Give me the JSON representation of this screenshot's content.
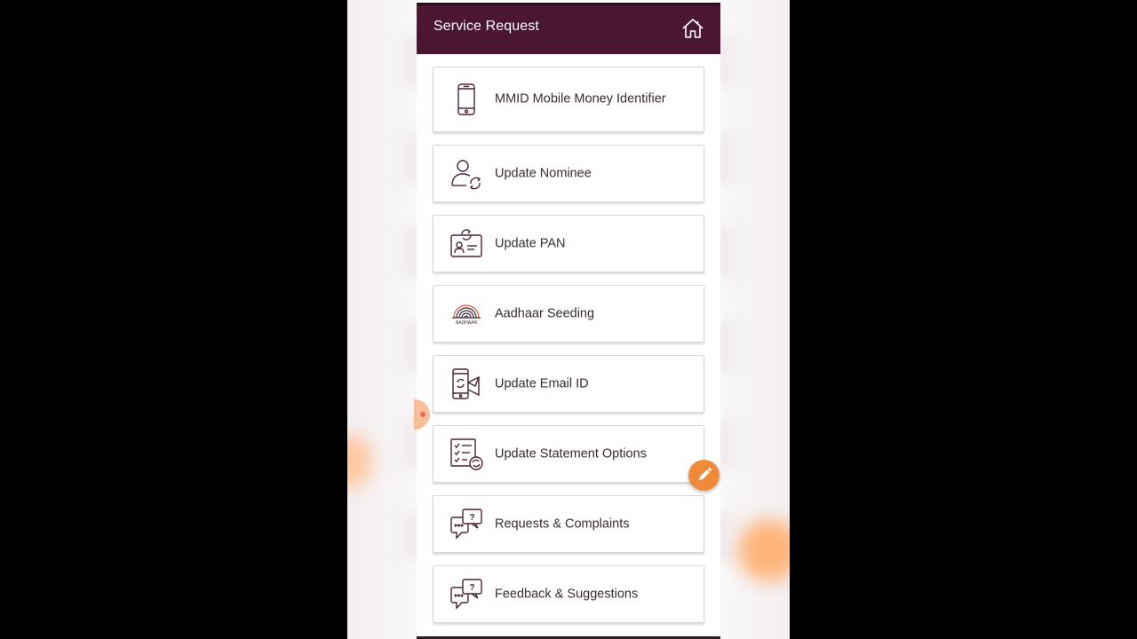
{
  "header": {
    "title": "Service Request",
    "home_icon": "home-icon",
    "background": "#4a1631"
  },
  "items": [
    {
      "label": "MMID Mobile Money Identifier",
      "icon": "mobile-phone-icon"
    },
    {
      "label": "Update Nominee",
      "icon": "user-refresh-icon"
    },
    {
      "label": "Update PAN",
      "icon": "id-card-refresh-icon"
    },
    {
      "label": "Aadhaar Seeding",
      "icon": "aadhaar-fingerprint-icon",
      "icon_text": "AADHAAR"
    },
    {
      "label": "Update Email ID",
      "icon": "phone-envelope-icon"
    },
    {
      "label": "Update Statement Options",
      "icon": "checklist-refresh-icon"
    },
    {
      "label": "Requests & Complaints",
      "icon": "chat-question-icon"
    },
    {
      "label": "Feedback & Suggestions",
      "icon": "chat-question-icon"
    }
  ],
  "overlay": {
    "edit_button_icon": "pencil-icon",
    "accent": "#f08a3a"
  }
}
